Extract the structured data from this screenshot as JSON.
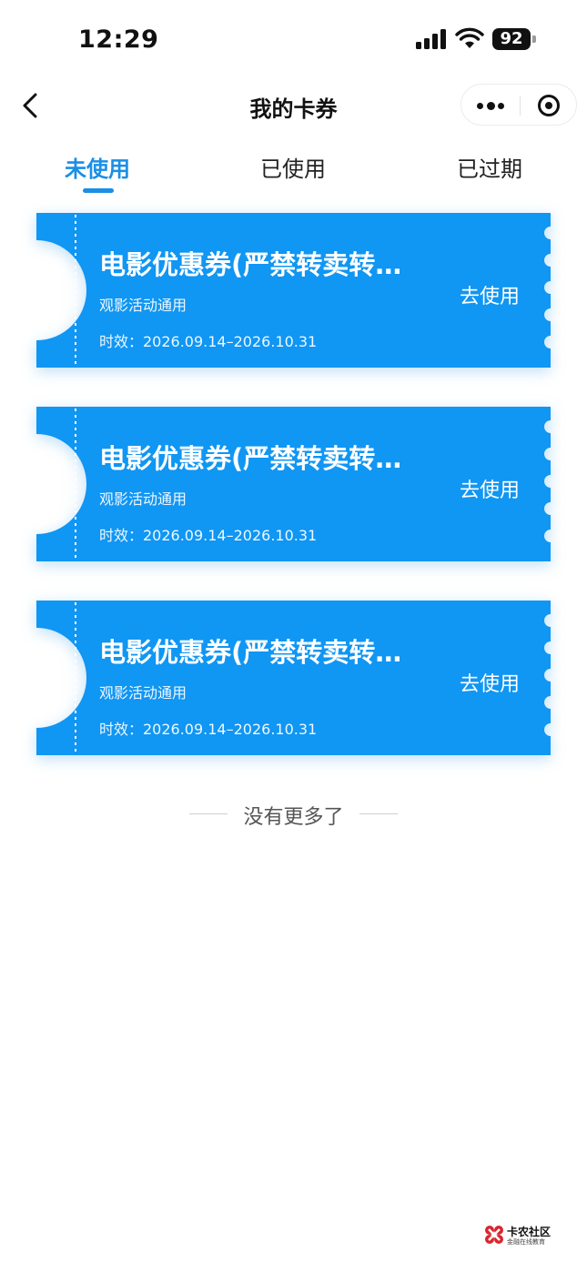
{
  "status_bar": {
    "time": "12:29",
    "battery": "92"
  },
  "nav": {
    "title": "我的卡券",
    "back_icon": "chevron-left-icon",
    "more_icon": "more-dots-icon",
    "close_icon": "target-circle-icon"
  },
  "tabs": [
    {
      "label": "未使用",
      "active": true
    },
    {
      "label": "已使用",
      "active": false
    },
    {
      "label": "已过期",
      "active": false
    }
  ],
  "coupons": [
    {
      "title": "电影优惠券(严禁转卖转…",
      "subtitle": "观影活动通用",
      "validity": "时效：2026.09.14–2026.10.31",
      "action": "去使用"
    },
    {
      "title": "电影优惠券(严禁转卖转…",
      "subtitle": "观影活动通用",
      "validity": "时效：2026.09.14–2026.10.31",
      "action": "去使用"
    },
    {
      "title": "电影优惠券(严禁转卖转…",
      "subtitle": "观影活动通用",
      "validity": "时效：2026.09.14–2026.10.31",
      "action": "去使用"
    }
  ],
  "footer": {
    "no_more": "没有更多了"
  },
  "watermark": {
    "title": "卡农社区",
    "subtitle": "金融在线教育"
  },
  "colors": {
    "accent": "#1a8fe6",
    "coupon_bg": "#1096f3"
  }
}
